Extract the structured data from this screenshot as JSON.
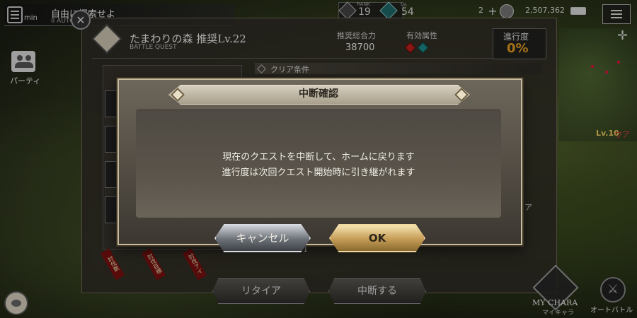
{
  "hud": {
    "timer_unit": "min",
    "mission_title": "自由に探索せよ",
    "mission_sub": "II AUTO",
    "rank_label": "RANK",
    "rank_value": "19",
    "lv_label": "Lv.",
    "lv_value": "54",
    "stamina": "2",
    "money": "2,507,362"
  },
  "side": {
    "party_label": "パーティ"
  },
  "quest": {
    "title": "たまわりの森 推奨Lv.22",
    "type": "BATTLE QUEST",
    "power_label": "推奨総合力",
    "power_value": "38700",
    "element_label": "有効属性",
    "progress_label": "進行度",
    "progress_value": "0%",
    "clear_condition_label": "クリア条件",
    "side_label": "リア",
    "page_num": "1",
    "reward_tags": [
      "討伐数",
      "討伐目標",
      "討伐アイ"
    ],
    "retire_label": "リタイア",
    "suspend_label": "中断する"
  },
  "enemy": {
    "level": "Lv.10",
    "name": "ウア"
  },
  "bottom_right": {
    "mychara_label": "MY CHARA",
    "mychara_sub": "マイキャラ",
    "auto_label": "オートバトル"
  },
  "modal": {
    "title": "中断確認",
    "line1": "現在のクエストを中断して、ホームに戻ります",
    "line2": "進行度は次回クエスト開始時に引き継がれます",
    "cancel_label": "キャンセル",
    "ok_label": "OK"
  },
  "colors": {
    "progress": "#e8a020",
    "fire_element": "#c02020",
    "water_element": "#1e8a8a",
    "ok_button": "#c49b55"
  }
}
